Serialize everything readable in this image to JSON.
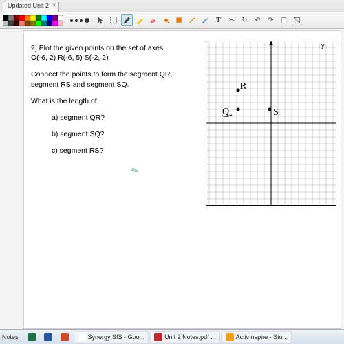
{
  "tab": {
    "title": "Updated Unit 2",
    "close": "✕"
  },
  "swatches": [
    "#000000",
    "#808080",
    "#800000",
    "#ff0000",
    "#ff8000",
    "#ffff00",
    "#008000",
    "#00ffff",
    "#0000ff",
    "#800080",
    "#ffffff",
    "#c0c0c0",
    "#404040",
    "#400000",
    "#ff8080",
    "#804000",
    "#808000",
    "#00ff00",
    "#008080",
    "#000080",
    "#ff00ff",
    "#ffc0cb"
  ],
  "tools": {
    "pointer": "pointer-icon",
    "select": "select-icon",
    "pen": "pen-icon",
    "highlighter": "highlighter-icon",
    "eraser": "eraser-icon",
    "fill": "fill-icon",
    "shape": "shape-icon",
    "connector": "connector-icon",
    "wand": "wand-icon",
    "text": "T",
    "cut": "✂",
    "redoarrow": "↻",
    "undo": "↶",
    "redo": "↷",
    "paste": "paste-icon",
    "reset": "reset-icon"
  },
  "problem": {
    "line1": "2] Plot the given points on the set of axes.",
    "line2": "Q(-6, 2) R(-6, 5) S(-2, 2)",
    "line3": "Connect the points to form the segment QR, segment RS and segment SQ.",
    "q": "What is the length of",
    "a": "a) segment QR?",
    "b": "b) segment SQ?",
    "c": "c) segment RS?"
  },
  "graph": {
    "ylabel": "y",
    "points": {
      "R": "R",
      "Q": "Q",
      "S": "S"
    }
  },
  "taskbar": {
    "notes": "Notes",
    "items": [
      {
        "name": "excel",
        "icon_bg": "#1f7246",
        "label": ""
      },
      {
        "name": "word",
        "icon_bg": "#2b579a",
        "label": ""
      },
      {
        "name": "ppt",
        "icon_bg": "#d24726",
        "label": ""
      },
      {
        "name": "chrome",
        "icon_bg": "#ffffff",
        "label": "Synergy SIS - Goo...",
        "active": true
      },
      {
        "name": "pdf",
        "icon_bg": "#c1272d",
        "label": "Unit 2 Notes.pdf ...",
        "active": true
      },
      {
        "name": "inspire",
        "icon_bg": "#f0a020",
        "label": "ActivInspire - Stu...",
        "active": true
      }
    ]
  }
}
